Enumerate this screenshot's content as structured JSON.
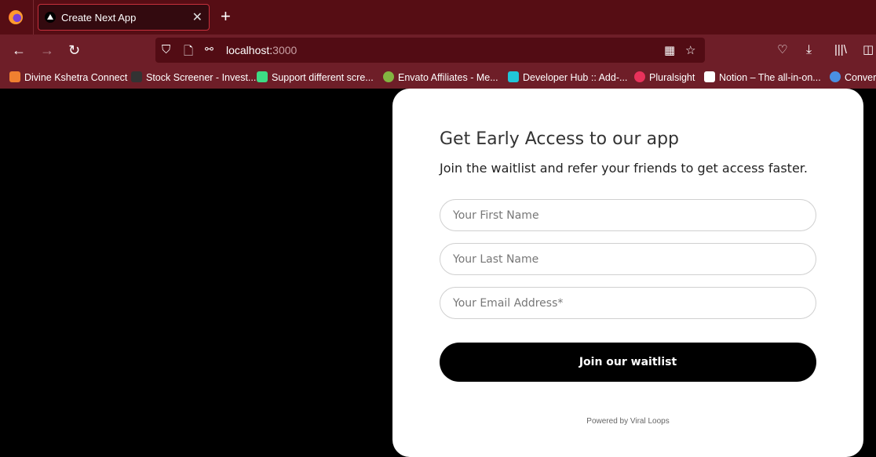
{
  "browser": {
    "tab": {
      "title": "Create Next App",
      "close": "✕"
    },
    "new_tab": "+",
    "nav": {
      "back": "←",
      "forward": "→",
      "reload": "↻"
    },
    "url": {
      "host": "localhost:",
      "port": "3000"
    },
    "toolbar_icons": [
      "qr-code-icon",
      "bookmark-star-icon",
      "pocket-icon",
      "download-icon",
      "library-icon",
      "sidebar-icon"
    ],
    "bookmarks": [
      {
        "label": "Divine Kshetra Connect",
        "color": "#f08030"
      },
      {
        "label": "Stock Screener - Invest...",
        "color": "#333333"
      },
      {
        "label": "Support different scre...",
        "color": "#3ddc84"
      },
      {
        "label": "Envato Affiliates - Me...",
        "color": "#82b541"
      },
      {
        "label": "Developer Hub :: Add-...",
        "color": "#20c5d8"
      },
      {
        "label": "Pluralsight",
        "color": "#e8325b"
      },
      {
        "label": "Notion – The all-in-on...",
        "color": "#ffffff"
      },
      {
        "label": "Convers",
        "color": "#4a90e2"
      }
    ]
  },
  "form": {
    "title": "Get Early Access to our app",
    "subtitle": "Join the waitlist and refer your friends to get access faster.",
    "first_name_placeholder": "Your First Name",
    "last_name_placeholder": "Your Last Name",
    "email_placeholder": "Your Email Address*",
    "submit_label": "Join our waitlist",
    "powered_by": "Powered by Viral Loops"
  }
}
